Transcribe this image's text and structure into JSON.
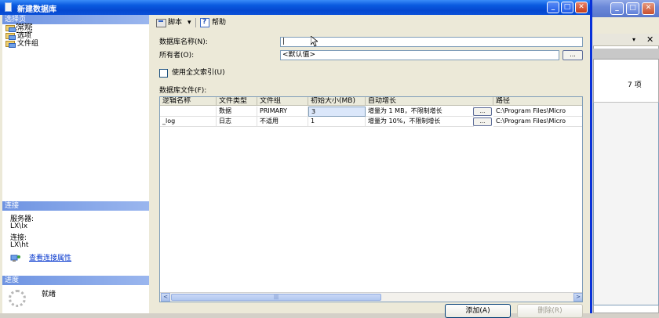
{
  "dialog": {
    "title": "新建数据库",
    "controls": {
      "minimize": "_",
      "maximize": "□",
      "close": "✕"
    }
  },
  "background_window": {
    "controls": {
      "minimize": "_",
      "maximize": "□",
      "close": "✕"
    },
    "pane_pin": "▾",
    "pane_close": "✕",
    "count": "7 项"
  },
  "left": {
    "select_page_header": "选择页",
    "nav": [
      {
        "label": "常规",
        "selected": true
      },
      {
        "label": "选项",
        "selected": false
      },
      {
        "label": "文件组",
        "selected": false
      }
    ],
    "connection_header": "连接",
    "server_label": "服务器:",
    "server_value": "LX\\lx",
    "connection_label": "连接:",
    "connection_value": "LX\\ht",
    "view_conn_link": "查看连接属性",
    "progress_header": "进度",
    "status": "就绪"
  },
  "toolbar": {
    "script_label": "脚本",
    "dropdown": "▾",
    "help_label": "帮助"
  },
  "form": {
    "db_name_label": "数据库名称(N):",
    "db_name_value": "|",
    "owner_label": "所有者(O):",
    "owner_value": "<默认值>",
    "owner_browse": "...",
    "fulltext_label": "使用全文索引(U)",
    "files_label": "数据库文件(F):"
  },
  "grid": {
    "headers": [
      "逻辑名称",
      "文件类型",
      "文件组",
      "初始大小(MB)",
      "自动增长",
      "路径"
    ],
    "rows": [
      [
        "",
        "数据",
        "PRIMARY",
        "3",
        "增量为 1 MB，不限制增长",
        "C:\\Program Files\\Micro"
      ],
      [
        "_log",
        "日志",
        "不适用",
        "1",
        "增量为 10%，不限制增长",
        "C:\\Program Files\\Micro"
      ]
    ],
    "cell_button": "...",
    "scroll_left": "<",
    "scroll_right": ">",
    "thumb_grip": "|||"
  },
  "buttons": {
    "add": "添加(A)",
    "remove": "删除(R)"
  }
}
